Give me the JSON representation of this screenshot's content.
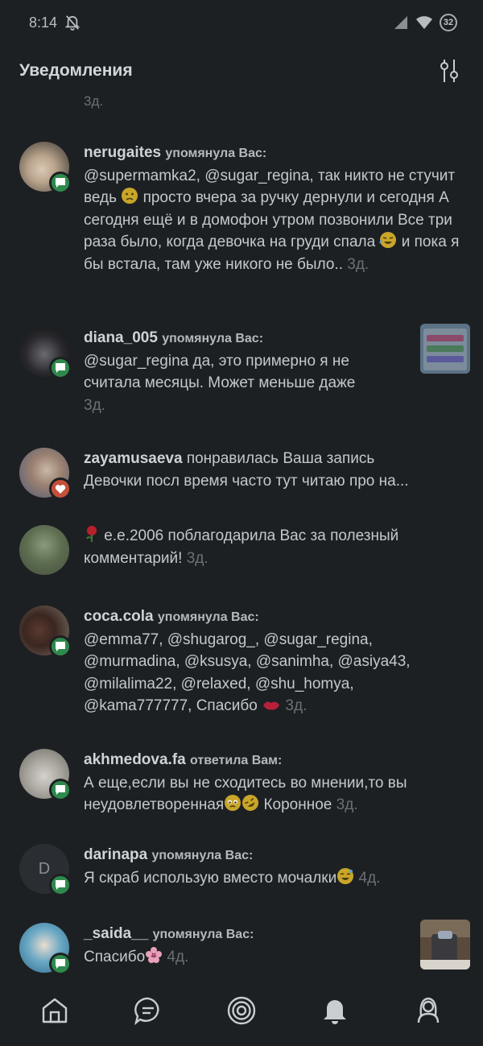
{
  "status": {
    "time": "8:14",
    "battery": "32"
  },
  "header": {
    "title": "Уведомления"
  },
  "partial_time": "3д.",
  "notifications": [
    {
      "username": "nerugaites",
      "action": "упомянула Вас:",
      "text_a": "@supermamka2, @sugar_regina, так никто не стучит ведь ",
      "text_b": " просто вчера за ручку дернули и сегодня А сегодня ещё и в домофон утром позвонили  Все три раза было, когда девочка на груди спала ",
      "text_c": " и пока я бы встала, там уже никого не было.. ",
      "time": "3д.",
      "badge": "comment-icon"
    },
    {
      "username": "diana_005",
      "action": "упомянула Вас:",
      "text": "@sugar_regina да, это примерно я не считала месяцы. Может меньше даже",
      "time": "3д.",
      "badge": "comment-icon"
    },
    {
      "username": "zayamusaeva",
      "action": "понравилась Ваша запись",
      "text": "Девочки посл время часто тут читаю про на...",
      "badge": "heart-icon"
    },
    {
      "username": "e.e.2006",
      "action": "поблагодарила Вас за полезный комментарий!",
      "time": "3д."
    },
    {
      "username": "coca.cola",
      "action": "упомянула Вас:",
      "text": "@emma77, @shugarog_, @sugar_regina, @murmadina, @ksusya, @sanimha, @asiya43, @milalima22, @relaxed, @shu_homya, @kama777777, Спасибо ",
      "time": "3д.",
      "badge": "comment-icon"
    },
    {
      "username": "akhmedova.fa",
      "action": "ответила Вам:",
      "text_a": "А еще,если вы не сходитесь во мнении,то вы неудовлетворенная",
      "text_b": " Коронное ",
      "time": "3д.",
      "badge": "comment-icon"
    },
    {
      "username": "darinapa",
      "avatar_letter": "D",
      "action": "упомянула Вас:",
      "text": "Я скраб использую вместо мочалки",
      "time": "4д.",
      "badge": "comment-icon"
    },
    {
      "username": "_saida__",
      "action": "упомянула Вас:",
      "text": "Спасибо",
      "time": "4д.",
      "badge": "comment-icon"
    }
  ],
  "nav": [
    "home-icon",
    "chat-icon",
    "target-icon",
    "bell-icon",
    "profile-icon"
  ]
}
